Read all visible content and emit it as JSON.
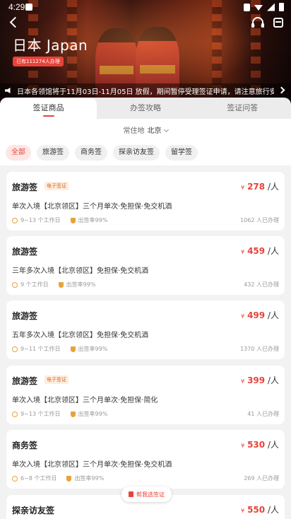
{
  "status_bar": {
    "time": "4:29"
  },
  "header": {
    "country": "日本 Japan",
    "applicants_badge": "已有111274人办理"
  },
  "notice": {
    "text": "日本各领馆将于11月03日-11月05日 放假，期间暂停受理签证申请，请注意旅行安排"
  },
  "tabs": [
    {
      "label": "签证商品",
      "active": true
    },
    {
      "label": "办签攻略",
      "active": false
    },
    {
      "label": "签证问答",
      "active": false
    }
  ],
  "region": {
    "label": "常住地",
    "value": "北京"
  },
  "filters": [
    "全部",
    "旅游签",
    "商务签",
    "探亲访友签",
    "留学签"
  ],
  "products": [
    {
      "name": "旅游签",
      "tag": "电子签证",
      "currency": "¥",
      "price": "278",
      "unit": "/人",
      "desc": "单次入境【北京领区】三个月单次·免担保·免交机酒",
      "days": "9~13 个工作日",
      "rate": "出签率99%",
      "count": "1062 人已办理"
    },
    {
      "name": "旅游签",
      "tag": "",
      "currency": "¥",
      "price": "459",
      "unit": "/人",
      "desc": "三年多次入境【北京领区】免担保·免交机酒",
      "days": "9 个工作日",
      "rate": "出签率99%",
      "count": "432 人已办理"
    },
    {
      "name": "旅游签",
      "tag": "",
      "currency": "¥",
      "price": "499",
      "unit": "/人",
      "desc": "五年多次入境【北京领区】免担保·免交机酒",
      "days": "9~11 个工作日",
      "rate": "出签率99%",
      "count": "1370 人已办理"
    },
    {
      "name": "旅游签",
      "tag": "电子签证",
      "currency": "¥",
      "price": "399",
      "unit": "/人",
      "desc": "单次入境【北京领区】三个月单次·免担保·简化",
      "days": "9~13 个工作日",
      "rate": "出签率99%",
      "count": "41 人已办理"
    },
    {
      "name": "商务签",
      "tag": "",
      "currency": "¥",
      "price": "530",
      "unit": "/人",
      "desc": "单次入境【北京领区】三个月单次·免担保·免交机酒",
      "days": "6~8 个工作日",
      "rate": "出签率99%",
      "count": "269 人已办理"
    },
    {
      "name": "探亲访友签",
      "tag": "",
      "currency": "¥",
      "price": "550",
      "unit": "/人"
    }
  ],
  "float_button": {
    "label": "帮我选签证"
  }
}
